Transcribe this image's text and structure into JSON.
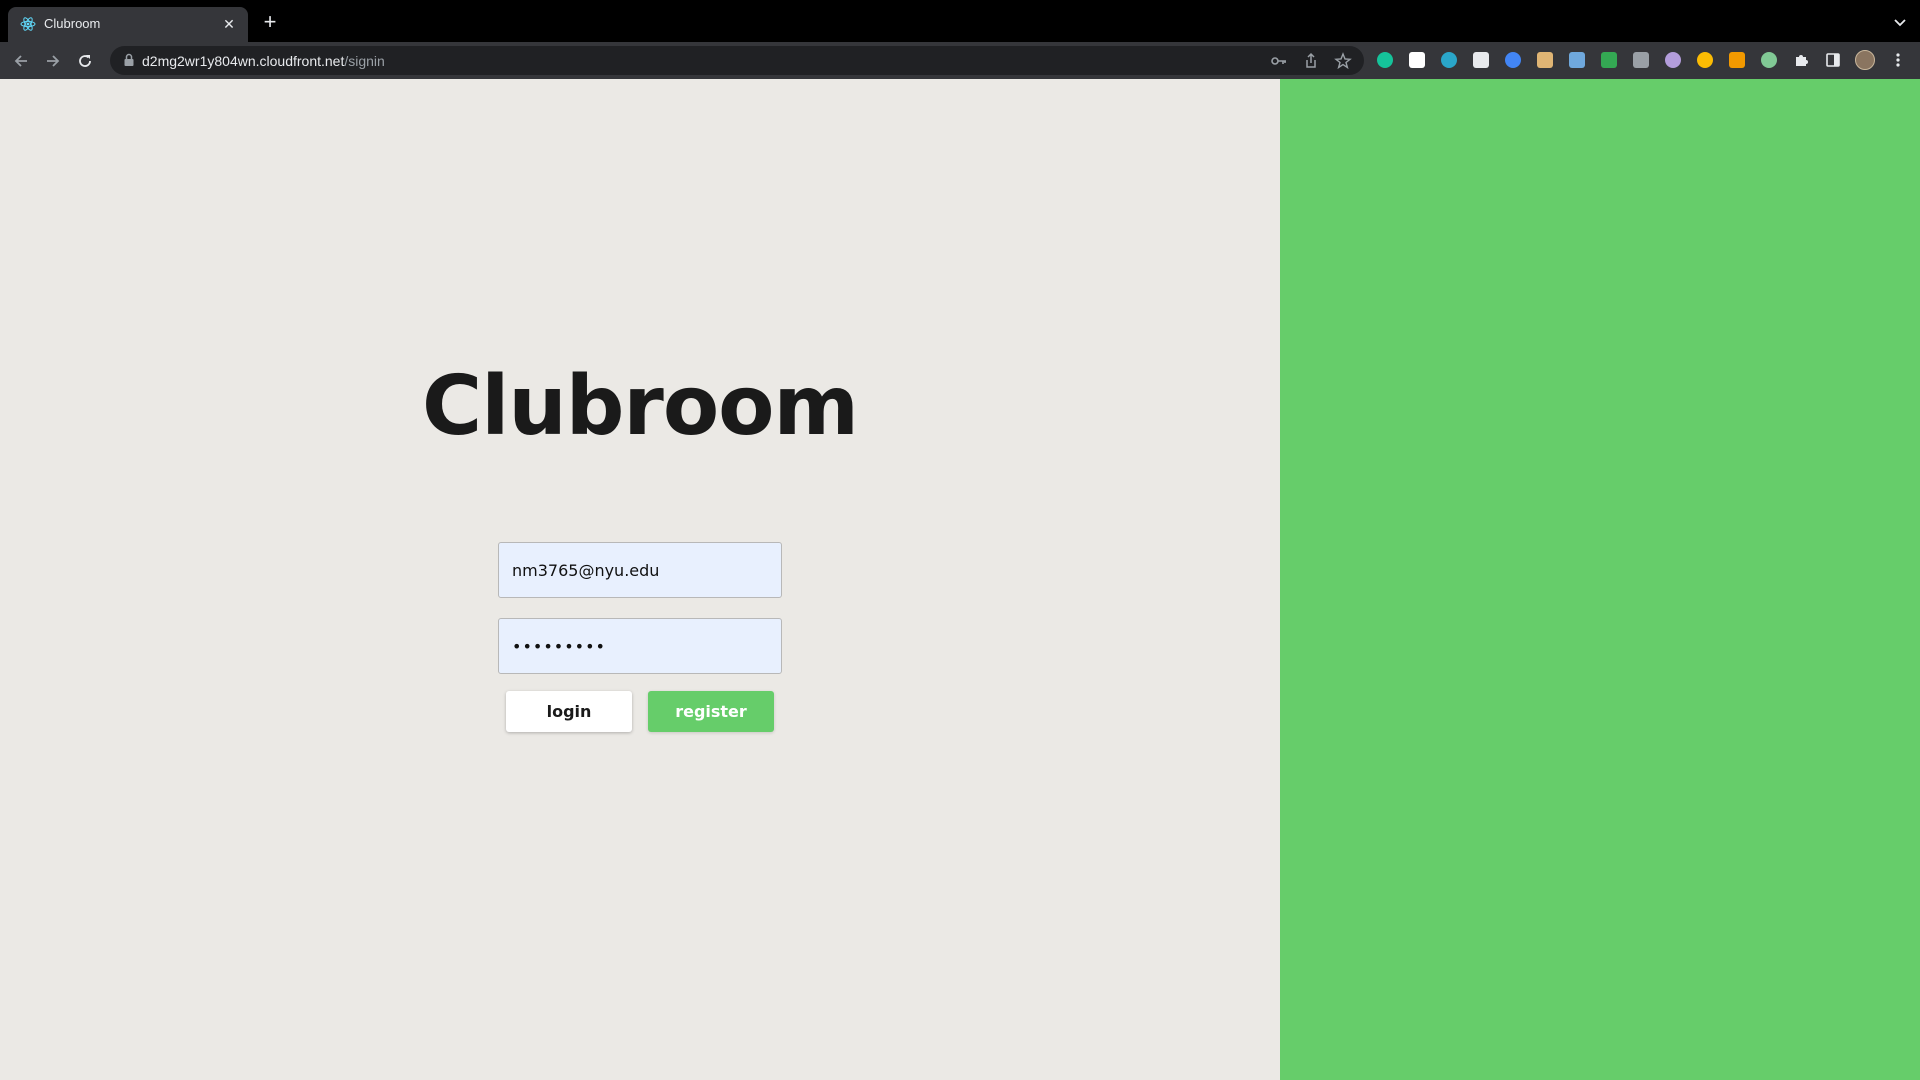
{
  "browser": {
    "tab": {
      "title": "Clubroom",
      "favicon": "react-atom-icon"
    },
    "url": {
      "host": "d2mg2wr1y804wn.cloudfront.net",
      "path": "/signin"
    },
    "extensions": [
      {
        "name": "grammarly-extension-icon",
        "color": "#15c39a",
        "shape": "dot"
      },
      {
        "name": "notion-extension-icon",
        "color": "#ffffff",
        "shape": "sq"
      },
      {
        "name": "m-extension-icon",
        "color": "#2aa6c9",
        "shape": "dot"
      },
      {
        "name": "plus-extension-icon",
        "color": "#e8eaed",
        "shape": "sq"
      },
      {
        "name": "clock-extension-icon",
        "color": "#4285f4",
        "shape": "dot"
      },
      {
        "name": "face-extension-icon",
        "color": "#e0b574",
        "shape": "sq"
      },
      {
        "name": "image-extension-icon",
        "color": "#6fa8dc",
        "shape": "sq"
      },
      {
        "name": "green-extension-icon",
        "color": "#34a853",
        "shape": "sq"
      },
      {
        "name": "reader-extension-icon",
        "color": "#9aa0a6",
        "shape": "sq"
      },
      {
        "name": "globe-extension-icon",
        "color": "#b39ddb",
        "shape": "dot"
      },
      {
        "name": "badge-extension-icon",
        "color": "#fbbc04",
        "shape": "dot"
      },
      {
        "name": "lh-extension-icon",
        "color": "#f29900",
        "shape": "sq"
      },
      {
        "name": "dropper-extension-icon",
        "color": "#81c995",
        "shape": "dot"
      }
    ]
  },
  "page": {
    "title": "Clubroom",
    "email": {
      "value": "nm3765@nyu.edu"
    },
    "password": {
      "value": "•••••••••"
    },
    "login_label": "login",
    "register_label": "register",
    "colors": {
      "left_bg": "#ebe9e5",
      "accent_green": "#66cd6a",
      "input_bg": "#e8f0fe"
    }
  }
}
